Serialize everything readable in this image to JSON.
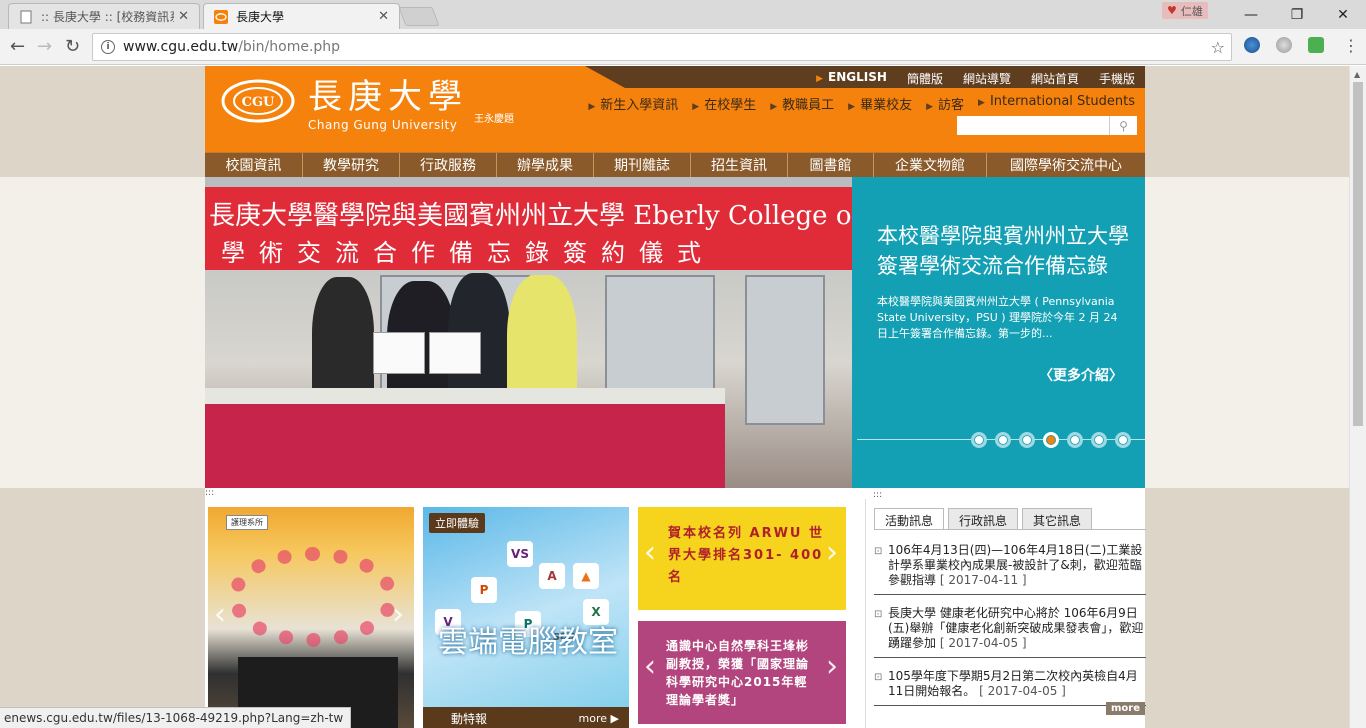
{
  "browser": {
    "tabs": [
      {
        "title": ":: 長庚大學 :: [校務資訊系"
      },
      {
        "title": "長庚大學"
      }
    ],
    "profile": "仁雄",
    "url_host": "www.cgu.edu.tw",
    "url_path": "/bin/home.php",
    "status_url": "enews.cgu.edu.tw/files/13-1068-49219.php?Lang=zh-tw"
  },
  "site": {
    "logo_cn": "長庚大學",
    "logo_en": "Chang Gung University",
    "logo_sig": "王永慶題",
    "top_links": [
      "ENGLISH",
      "簡體版",
      "網站導覽",
      "網站首頁",
      "手機版"
    ],
    "sub_links": [
      "新生入學資訊",
      "在校學生",
      "教職員工",
      "畢業校友",
      "訪客",
      "International Students"
    ],
    "search_placeholder": "",
    "main_nav": [
      "校園資訊",
      "教學研究",
      "行政服務",
      "辦學成果",
      "期刊雜誌",
      "招生資訊",
      "圖書館",
      "企業文物館",
      "國際學術交流中心"
    ]
  },
  "hero": {
    "banner_line1": "長庚大學醫學院與美國賓州州立大學 Eberly College of Science",
    "banner_line2": "學術交流合作備忘錄簽約儀式",
    "headline": "本校醫學院與賓州州立大學簽署學術交流合作備忘錄",
    "summary": "本校醫學院與美國賓州州立大學 ( Pennsylvania State University，PSU ) 理學院於今年 2 月 24 日上午簽署合作備忘錄。第一步的...",
    "more": "〈更多介紹〉",
    "slides": 7,
    "active_slide": 4
  },
  "tiles": {
    "grad_sign": "護理系所",
    "cloud_label": "立即體驗",
    "cloud_title": "雲端電腦教室",
    "cloud_foot": "動特報",
    "cloud_more": "more ▶",
    "arwu": "賀本校名列 ARWU 世界大學排名301- 400名",
    "science": "通識中心自然學科王埄彬副教授，榮獲「國家理論科學研究中心2015年輕理論學者獎」"
  },
  "news": {
    "tabs": [
      "活動訊息",
      "行政訊息",
      "其它訊息"
    ],
    "items": [
      {
        "text": "106年4月13日(四)—106年4月18日(二)工業設計學系畢業校內成果展-被設計了&刺，歡迎蒞臨參觀指導",
        "date": "[ 2017-04-11 ]"
      },
      {
        "text": "長庚大學 健康老化研究中心將於 106年6月9日(五)舉辦「健康老化創新突破成果發表會」，歡迎踴躍參加",
        "date": "[ 2017-04-05 ]"
      },
      {
        "text": "105學年度下學期5月2日第二次校內英檢自4月11日開始報名。",
        "date": "[ 2017-04-05 ]"
      }
    ],
    "more": "more"
  },
  "colors": {
    "orange": "#f5820d",
    "brown": "#8b5a2a",
    "teal": "#14a0b4"
  }
}
